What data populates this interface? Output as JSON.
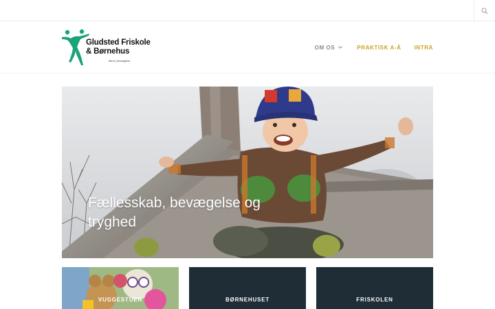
{
  "topbar": {
    "search_icon": "search-icon"
  },
  "logo": {
    "line1": "Gludsted Friskole",
    "line2": "& Børnehus",
    "tagline": "Mind | bevægelse"
  },
  "nav": {
    "items": [
      {
        "label": "OM OS",
        "has_dropdown": true
      },
      {
        "label": "PRAKTISK A-Å",
        "has_dropdown": false
      },
      {
        "label": "INTRA",
        "has_dropdown": false
      }
    ]
  },
  "hero": {
    "title": "Fællesskab, bevægelse og tryghed"
  },
  "cards": [
    {
      "label": "VUGGESTUEN"
    },
    {
      "label": "BØRNEHUSET"
    },
    {
      "label": "FRISKOLEN"
    }
  ],
  "colors": {
    "accent_gold": "#c9a227",
    "nav_gray": "#8a8a8a",
    "logo_green": "#1aa37a",
    "card_dark": "#1e2d36"
  }
}
